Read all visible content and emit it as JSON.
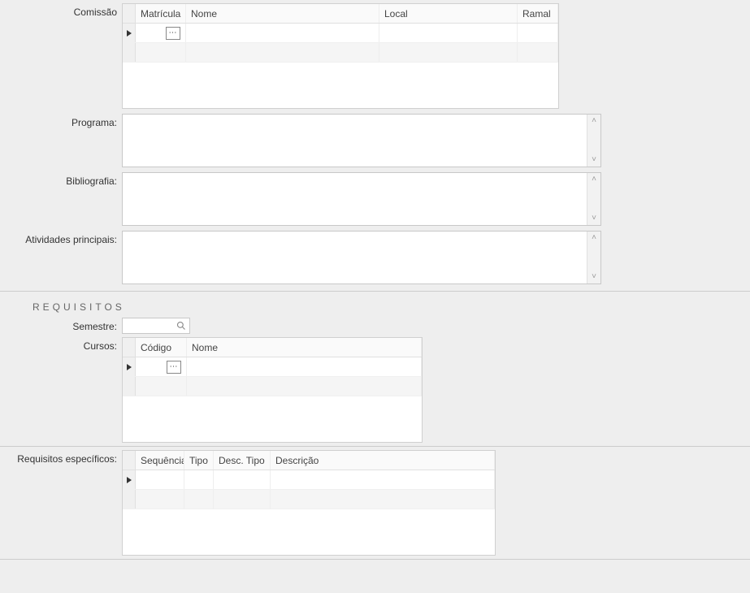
{
  "comissao": {
    "label": "Comissão",
    "columns": {
      "matricula": "Matrícula",
      "nome": "Nome",
      "local": "Local",
      "ramal": "Ramal"
    }
  },
  "programa": {
    "label": "Programa:",
    "value": ""
  },
  "bibliografia": {
    "label": "Bibliografia:",
    "value": ""
  },
  "atividades": {
    "label": "Atividades principais:",
    "value": ""
  },
  "requisitos_section": "REQUISITOS",
  "semestre": {
    "label": "Semestre:",
    "value": ""
  },
  "cursos": {
    "label": "Cursos:",
    "columns": {
      "codigo": "Código",
      "nome": "Nome"
    }
  },
  "requisitos_especificos": {
    "label": "Requisitos específicos:",
    "columns": {
      "sequencia": "Sequência",
      "tipo": "Tipo",
      "desctipo": "Desc. Tipo",
      "descricao": "Descrição"
    }
  }
}
